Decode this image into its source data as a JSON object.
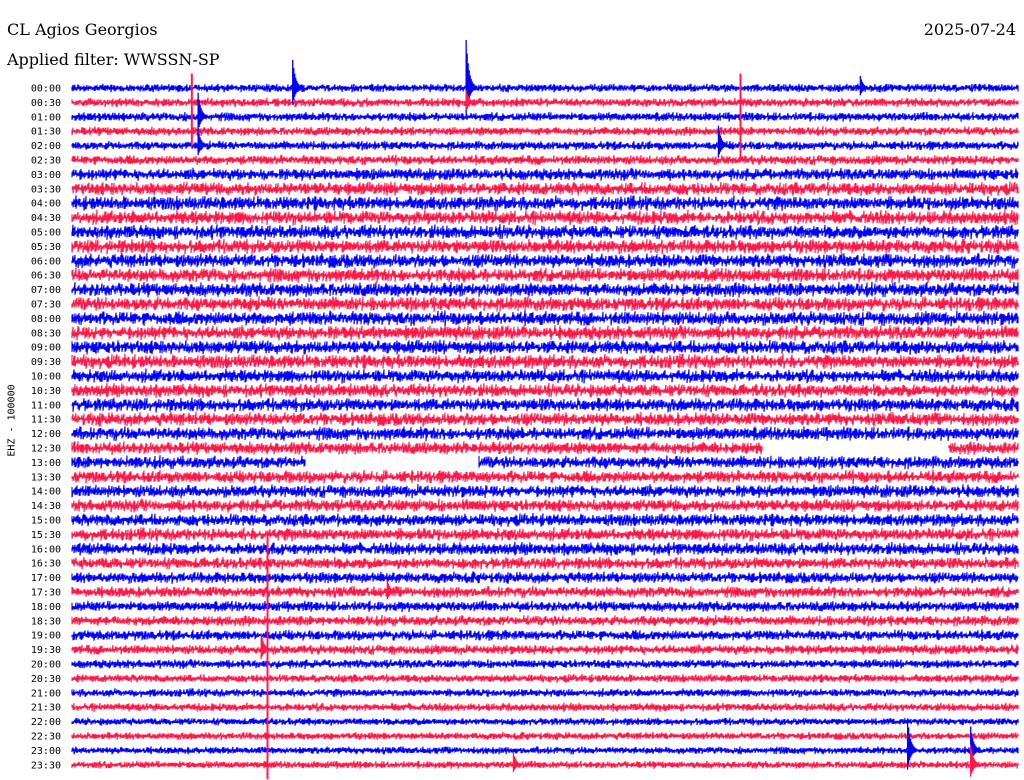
{
  "header": {
    "station": "CL Agios Georgios",
    "filter": "Applied filter: WWSSN-SP",
    "date": "2025-07-24"
  },
  "chart_data": {
    "type": "line",
    "ylabel": "EHZ - 100000",
    "row_labels": [
      "00:00",
      "00:30",
      "01:00",
      "01:30",
      "02:00",
      "02:30",
      "03:00",
      "03:30",
      "04:00",
      "04:30",
      "05:00",
      "05:30",
      "06:00",
      "06:30",
      "07:00",
      "07:30",
      "08:00",
      "08:30",
      "09:00",
      "09:30",
      "10:00",
      "10:30",
      "11:00",
      "11:30",
      "12:00",
      "12:30",
      "13:00",
      "13:30",
      "14:00",
      "14:30",
      "15:00",
      "15:30",
      "16:00",
      "16:30",
      "17:00",
      "17:30",
      "18:00",
      "18:30",
      "19:00",
      "19:30",
      "20:00",
      "20:30",
      "21:00",
      "21:30",
      "22:00",
      "22:30",
      "23:00",
      "23:30"
    ],
    "colors": [
      "#0000ff",
      "#ff1a4a"
    ],
    "noise_level": [
      0.55,
      0.6,
      0.6,
      0.6,
      0.6,
      0.65,
      0.8,
      0.9,
      0.95,
      0.95,
      0.95,
      0.95,
      0.95,
      0.95,
      0.95,
      0.95,
      0.95,
      0.95,
      0.95,
      0.95,
      0.9,
      0.9,
      0.9,
      0.9,
      0.9,
      0.85,
      0.85,
      0.85,
      0.85,
      0.85,
      0.85,
      0.85,
      0.85,
      0.8,
      0.75,
      0.75,
      0.7,
      0.7,
      0.7,
      0.65,
      0.6,
      0.55,
      0.55,
      0.55,
      0.5,
      0.5,
      0.5,
      0.5
    ],
    "events": [
      {
        "row": 0,
        "minute": 7,
        "amplitude": 3.5
      },
      {
        "row": 0,
        "minute": 12.5,
        "amplitude": 6
      },
      {
        "row": 0,
        "minute": 25,
        "amplitude": 1.5
      },
      {
        "row": 1,
        "minute": 12.5,
        "amplitude": 1.5
      },
      {
        "row": 2,
        "minute": 4,
        "amplitude": 3
      },
      {
        "row": 4,
        "minute": 20.5,
        "amplitude": 2.5
      },
      {
        "row": 4,
        "minute": 4,
        "amplitude": 2
      },
      {
        "row": 46,
        "minute": 26.5,
        "amplitude": 4
      },
      {
        "row": 46,
        "minute": 28.5,
        "amplitude": 3
      },
      {
        "row": 47,
        "minute": 14,
        "amplitude": 1.5
      },
      {
        "row": 47,
        "minute": 28.5,
        "amplitude": 2.5
      },
      {
        "row": 39,
        "minute": 6,
        "amplitude": 2
      },
      {
        "row": 35,
        "minute": 10,
        "amplitude": 1.5
      }
    ],
    "long_spikes": [
      {
        "minute": 3.8,
        "from_row": -1,
        "to_row": 4
      },
      {
        "minute": 21.2,
        "from_row": -1,
        "to_row": 5
      },
      {
        "minute": 6.2,
        "from_row": 31,
        "to_row": 48
      }
    ],
    "gaps": [
      {
        "row": 25,
        "from_minute": 21.9,
        "to_minute": 27.8
      },
      {
        "row": 26,
        "from_minute": 7.4,
        "to_minute": 12.9
      }
    ]
  }
}
